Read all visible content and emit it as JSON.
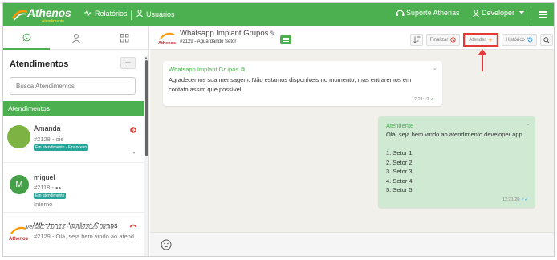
{
  "topbar": {
    "logo_text": "Athenos",
    "logo_sub": "Atendimento",
    "nav_relatorios": "Relatórios",
    "nav_usuarios": "Usuários",
    "support": "Suporte Athenas",
    "user": "Developer",
    "brand_color": "#4caf50"
  },
  "left": {
    "title": "Atendimentos",
    "search_placeholder": "Busca Atendimentos",
    "group_label": "Atendimentos",
    "items": [
      {
        "name": "Amanda",
        "sub": "#2128 - oie",
        "badge": "Em atendimento - Financeiro"
      },
      {
        "name": "miguel",
        "sub": "#2118 - ",
        "badge": "Em atendimento",
        "extra": "Interno",
        "avatar_letter": "M"
      },
      {
        "name": "Whatsapp Implant Grupos",
        "sub": "#2129 - Olá, seja bem vindo ao atend..."
      }
    ],
    "version": "Versão: 2.0.113 - 04/08/2025 08:46"
  },
  "chat": {
    "title": "Whatsapp Implant Grupos",
    "subtitle": "#2129 - Aguardando Setor",
    "buttons": {
      "finalizar": "Finalizar",
      "atender": "Atender",
      "historico": "Histórico"
    },
    "messages": [
      {
        "sender": "Whatsapp Implant Grupos",
        "lines": [
          "Agradecemos sua mensagem. Não estamos disponíveis no momento, mas entraremos em",
          "contato assim que possível."
        ],
        "time": "12:21:19"
      },
      {
        "sender": "Atendente",
        "lines": [
          "Olá, seja bem vindo ao atendimento developer app.",
          "",
          "1. Setor 1",
          "2. Setor 2",
          "3. Setor 3",
          "4. Setor 4",
          "5. Setor 5"
        ],
        "time": "12:21:20"
      }
    ],
    "highlight_color": "#e53935"
  }
}
